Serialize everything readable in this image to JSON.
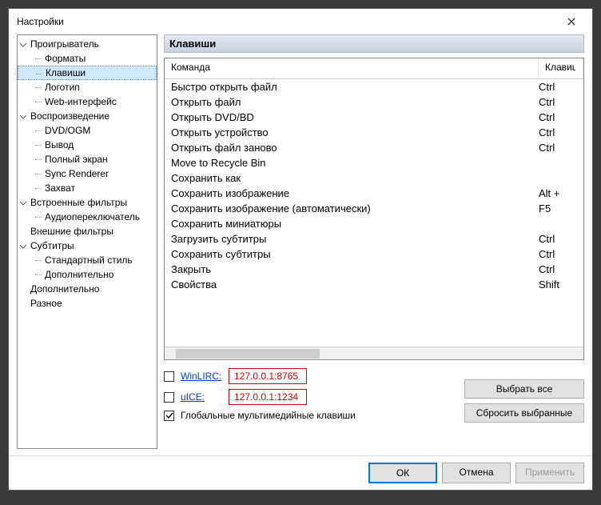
{
  "window": {
    "title": "Настройки"
  },
  "tree": {
    "player": "Проигрыватель",
    "formats": "Форматы",
    "keys": "Клавиши",
    "logo": "Логотип",
    "web": "Web-интерфейс",
    "playback": "Воспроизведение",
    "dvdogm": "DVD/OGM",
    "output": "Вывод",
    "fullscreen": "Полный экран",
    "sync": "Sync Renderer",
    "capture": "Захват",
    "intfilters": "Встроенные фильтры",
    "audioswitch": "Аудиопереключатель",
    "extfilters": "Внешние фильтры",
    "subs": "Субтитры",
    "stdstyle": "Стандартный стиль",
    "advanced": "Дополнительно",
    "advanced2": "Дополнительно",
    "misc": "Разное"
  },
  "section_title": "Клавиши",
  "table": {
    "col_cmd": "Команда",
    "col_key": "Клавиши",
    "rows": [
      {
        "cmd": "Быстро открыть файл",
        "key": "Ctrl"
      },
      {
        "cmd": "Открыть файл",
        "key": "Ctrl"
      },
      {
        "cmd": "Открыть DVD/BD",
        "key": "Ctrl"
      },
      {
        "cmd": "Открыть устройство",
        "key": "Ctrl"
      },
      {
        "cmd": "Открыть файл заново",
        "key": "Ctrl"
      },
      {
        "cmd": "Move to Recycle Bin",
        "key": ""
      },
      {
        "cmd": "Сохранить как",
        "key": ""
      },
      {
        "cmd": "Сохранить изображение",
        "key": "Alt +"
      },
      {
        "cmd": "Сохранить изображение (автоматически)",
        "key": "F5"
      },
      {
        "cmd": "Сохранить миниатюры",
        "key": ""
      },
      {
        "cmd": "Загрузить субтитры",
        "key": "Ctrl"
      },
      {
        "cmd": "Сохранить субтитры",
        "key": "Ctrl"
      },
      {
        "cmd": "Закрыть",
        "key": "Ctrl"
      },
      {
        "cmd": "Свойства",
        "key": "Shift"
      }
    ]
  },
  "controls": {
    "winlirc_label": "WinLIRC:",
    "winlirc_value": "127.0.0.1:8765",
    "uice_label": "uICE:",
    "uice_value": "127.0.0.1:1234",
    "global_media": "Глобальные мультимедийные клавиши",
    "select_all": "Выбрать все",
    "reset_selected": "Сбросить выбранные"
  },
  "footer": {
    "ok": "ОК",
    "cancel": "Отмена",
    "apply": "Применить"
  }
}
